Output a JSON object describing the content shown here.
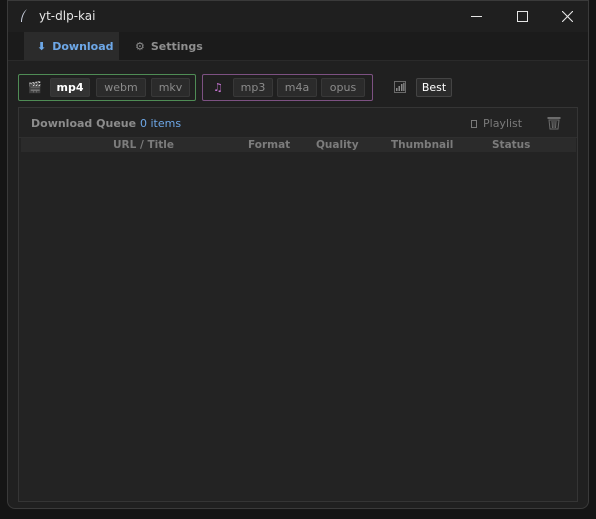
{
  "window": {
    "title": "yt-dlp-kai"
  },
  "tabs": [
    {
      "label": "Download",
      "icon": "download-arrow-icon"
    },
    {
      "label": "Settings",
      "icon": "gear-icon"
    }
  ],
  "video_formats": {
    "icon": "video-clapper-icon",
    "accent": "#4f8c55",
    "items": [
      "mp4",
      "webm",
      "mkv"
    ],
    "selected": "mp4"
  },
  "audio_formats": {
    "icon": "music-note-icon",
    "accent": "#7d5182",
    "items": [
      "mp3",
      "m4a",
      "opus"
    ]
  },
  "quality": {
    "icon": "signal-bars-icon",
    "label": "Best"
  },
  "queue": {
    "title": "Download Queue",
    "count": "0 items",
    "playlist_label": "Playlist",
    "columns": [
      "URL / Title",
      "Format",
      "Quality",
      "Thumbnail",
      "Status"
    ]
  }
}
